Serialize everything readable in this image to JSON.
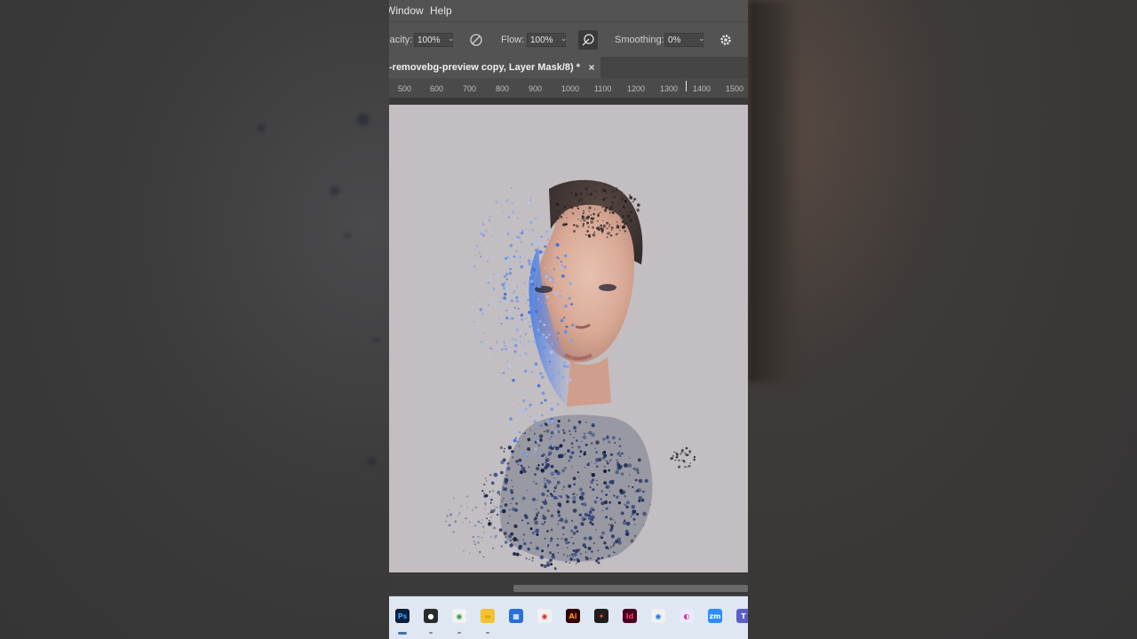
{
  "menu": {
    "window_label": "Window",
    "help_label": "Help"
  },
  "options": {
    "opacity_label": "Opacity:",
    "opacity_value": "100%",
    "flow_label": "Flow:",
    "flow_value": "100%",
    "smoothing_label": "Smoothing:",
    "smoothing_value": "0%"
  },
  "document_tab": {
    "title": "-removebg-preview copy, Layer Mask/8) *",
    "close_glyph": "×"
  },
  "ruler": {
    "ticks": [
      "500",
      "600",
      "700",
      "800",
      "900",
      "1000",
      "1100",
      "1200",
      "1300",
      "1400",
      "1500"
    ]
  },
  "taskbar": {
    "apps": [
      {
        "name": "Photoshop",
        "glyph": "Ps",
        "color": "#0b1e3a",
        "fg": "#31a8ff"
      },
      {
        "name": "OBS",
        "glyph": "●",
        "color": "#2b2b2b",
        "fg": "#ffffff"
      },
      {
        "name": "Chrome",
        "glyph": "◉",
        "color": "#f1f1f1",
        "fg": "#2f9e44"
      },
      {
        "name": "File Explorer",
        "glyph": "▬",
        "color": "#f2c230",
        "fg": "#e0a800"
      },
      {
        "name": "Store",
        "glyph": "▦",
        "color": "#2a6fd6",
        "fg": "#ffffff"
      },
      {
        "name": "Chrome 2",
        "glyph": "◉",
        "color": "#f1f1f1",
        "fg": "#d93025"
      },
      {
        "name": "Illustrator",
        "glyph": "Ai",
        "color": "#330000",
        "fg": "#ff9a00"
      },
      {
        "name": "Figma",
        "glyph": "✦",
        "color": "#1e1e1e",
        "fg": "#f24e1e"
      },
      {
        "name": "InDesign",
        "glyph": "Id",
        "color": "#49021f",
        "fg": "#ff3366"
      },
      {
        "name": "Chrome 3",
        "glyph": "◉",
        "color": "#f1f1f1",
        "fg": "#1a73e8"
      },
      {
        "name": "Photos",
        "glyph": "◐",
        "color": "#e8e8ff",
        "fg": "#d0309a"
      },
      {
        "name": "Zoom",
        "glyph": "zm",
        "color": "#2d8cff",
        "fg": "#ffffff"
      },
      {
        "name": "Teams",
        "glyph": "T",
        "color": "#5b5fc7",
        "fg": "#ffffff"
      }
    ]
  }
}
